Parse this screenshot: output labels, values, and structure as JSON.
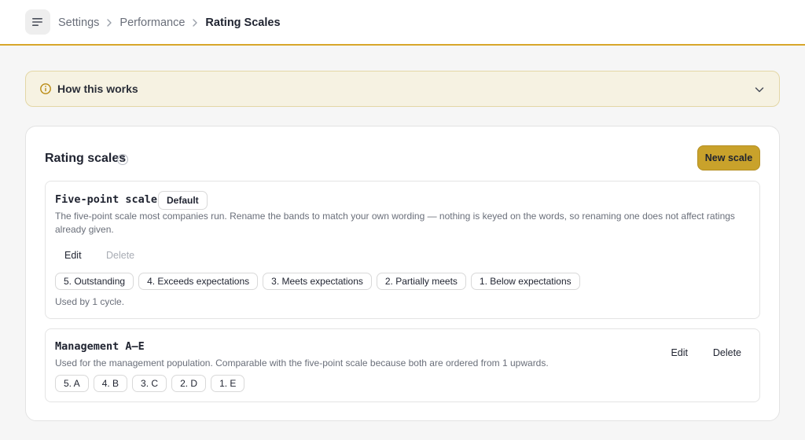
{
  "header": {
    "menu_icon": "menu-lines-icon",
    "breadcrumb": [
      "Settings",
      "Performance",
      "Rating Scales"
    ]
  },
  "howto": {
    "label": "How this works",
    "icon": "info-icon",
    "expanded": false
  },
  "rating_scales": {
    "title": "Rating scales",
    "help_glyph": "?",
    "new_button": "New scale",
    "accent_color": "#c9a22b",
    "scales": [
      {
        "name": "Five-point scale",
        "tag": "Default",
        "description": "The five-point scale most companies run. Rename the bands to match your own wording — nothing is keyed on the words, so renaming one does not affect ratings already given.",
        "edit_label": "Edit",
        "delete_label": "Delete",
        "delete_disabled": true,
        "bands": [
          "5. Outstanding",
          "4. Exceeds expectations",
          "3. Meets expectations",
          "2. Partially meets",
          "1. Below expectations"
        ],
        "usage": "Used by 1 cycle."
      },
      {
        "name": "Management A–E",
        "description": "Used for the management population. Comparable with the five-point scale because both are ordered from 1 upwards.",
        "edit_label": "Edit",
        "delete_label": "Delete",
        "delete_disabled": false,
        "bands": [
          "5. A",
          "4. B",
          "3. C",
          "2. D",
          "1. E"
        ]
      }
    ]
  }
}
